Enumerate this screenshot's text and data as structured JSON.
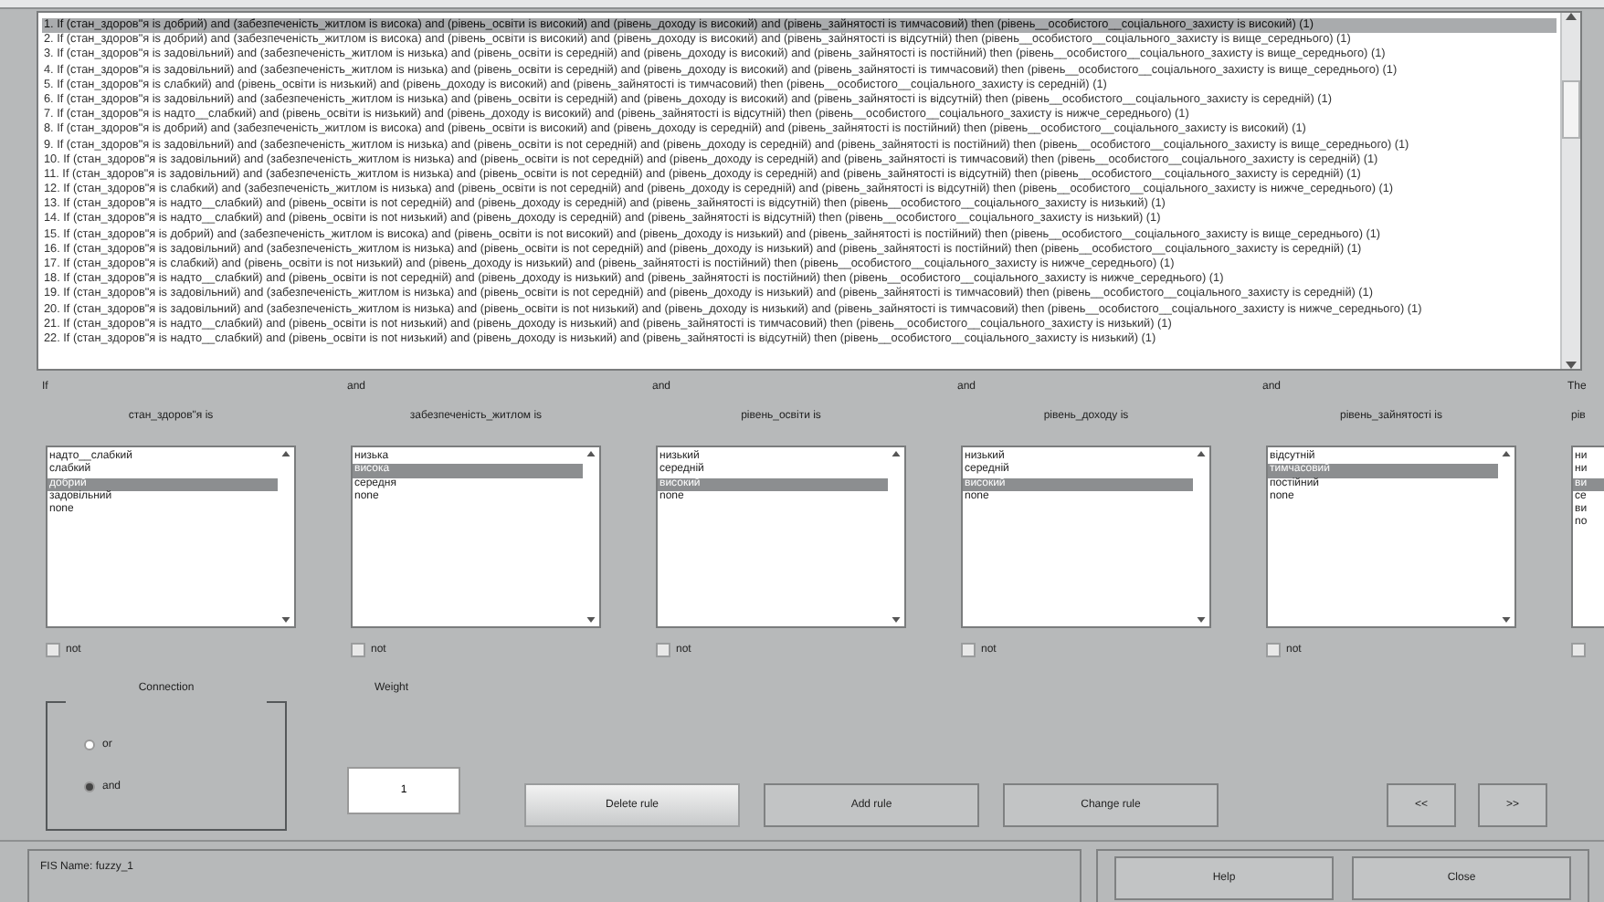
{
  "rules": [
    {
      "text": "1. If (стан_здоров\"я is добрий) and (забезпеченість_житлом is висока) and (рівень_освіти is високий) and (рівень_доходу is високий) and (рівень_зайнятості is тимчасовий) then (рівень__особистого__соціального_захисту is високий) (1)",
      "selected": true
    },
    {
      "text": "2. If (стан_здоров\"я is добрий) and (забезпеченість_житлом is висока) and (рівень_освіти is високий) and (рівень_доходу is високий) and (рівень_зайнятості is відсутній) then (рівень__особистого__соціального_захисту is вище_середнього) (1)",
      "selected": false
    },
    {
      "text": "3. If (стан_здоров\"я is задовільний) and (забезпеченість_житлом is низька) and (рівень_освіти is середній) and (рівень_доходу is високий) and (рівень_зайнятості is постійний) then (рівень__особистого__соціального_захисту is вище_середнього) (1)",
      "selected": false
    },
    {
      "text": "4. If (стан_здоров\"я is задовільний) and (забезпеченість_житлом is низька) and (рівень_освіти is середній) and (рівень_доходу is високий) and (рівень_зайнятості is тимчасовий) then (рівень__особистого__соціального_захисту is вище_середнього) (1)",
      "selected": false
    },
    {
      "text": "5. If (стан_здоров\"я is слабкий) and (рівень_освіти is низький) and (рівень_доходу is високий) and (рівень_зайнятості is тимчасовий) then (рівень__особистого__соціального_захисту is середній) (1)",
      "selected": false
    },
    {
      "text": "6. If (стан_здоров\"я is задовільний) and (забезпеченість_житлом is низька) and (рівень_освіти is середній) and (рівень_доходу is високий) and (рівень_зайнятості is відсутній) then (рівень__особистого__соціального_захисту is середній) (1)",
      "selected": false
    },
    {
      "text": "7. If (стан_здоров\"я is надто__слабкий) and (рівень_освіти is низький) and (рівень_доходу is високий) and (рівень_зайнятості is відсутній) then (рівень__особистого__соціального_захисту is нижче_середнього) (1)",
      "selected": false
    },
    {
      "text": "8. If (стан_здоров\"я is добрий) and (забезпеченість_житлом is висока) and (рівень_освіти is високий) and (рівень_доходу is середній) and (рівень_зайнятості is постійний) then (рівень__особистого__соціального_захисту is високий) (1)",
      "selected": false
    },
    {
      "text": "9. If (стан_здоров\"я is задовільний) and (забезпеченість_житлом is низька) and (рівень_освіти is not середній) and (рівень_доходу is середній) and (рівень_зайнятості is постійний) then (рівень__особистого__соціального_захисту is вище_середнього) (1)",
      "selected": false
    },
    {
      "text": "10. If (стан_здоров\"я is задовільний) and (забезпеченість_житлом is низька) and (рівень_освіти is not середній) and (рівень_доходу is середній) and (рівень_зайнятості is тимчасовий) then (рівень__особистого__соціального_захисту is середній) (1)",
      "selected": false
    },
    {
      "text": "11. If (стан_здоров\"я is задовільний) and (забезпеченість_житлом is низька) and (рівень_освіти is not середній) and (рівень_доходу is середній) and (рівень_зайнятості is відсутній) then (рівень__особистого__соціального_захисту is середній) (1)",
      "selected": false
    },
    {
      "text": "12. If (стан_здоров\"я is слабкий) and (забезпеченість_житлом is низька) and (рівень_освіти is not середній) and (рівень_доходу is середній) and (рівень_зайнятості is відсутній) then (рівень__особистого__соціального_захисту is нижче_середнього) (1)",
      "selected": false
    },
    {
      "text": "13. If (стан_здоров\"я is надто__слабкий) and (рівень_освіти is not середній) and (рівень_доходу is середній) and (рівень_зайнятості is відсутній) then (рівень__особистого__соціального_захисту is низький) (1)",
      "selected": false
    },
    {
      "text": "14. If (стан_здоров\"я is надто__слабкий) and (рівень_освіти is not низький) and (рівень_доходу is середній) and (рівень_зайнятості is відсутній) then (рівень__особистого__соціального_захисту is низький) (1)",
      "selected": false
    },
    {
      "text": "15. If (стан_здоров\"я is добрий) and (забезпеченість_житлом is висока) and (рівень_освіти is not високий) and (рівень_доходу is низький) and (рівень_зайнятості is постійний) then (рівень__особистого__соціального_захисту is вище_середнього) (1)",
      "selected": false
    },
    {
      "text": "16. If (стан_здоров\"я is задовільний) and (забезпеченість_житлом is низька) and (рівень_освіти is not середній) and (рівень_доходу is низький) and (рівень_зайнятості is постійний) then (рівень__особистого__соціального_захисту is середній) (1)",
      "selected": false
    },
    {
      "text": "17. If (стан_здоров\"я is слабкий) and (рівень_освіти is not низький) and (рівень_доходу is низький) and (рівень_зайнятості is постійний) then (рівень__особистого__соціального_захисту is нижче_середнього) (1)",
      "selected": false
    },
    {
      "text": "18. If (стан_здоров\"я is надто__слабкий) and (рівень_освіти is not середній) and (рівень_доходу is низький) and (рівень_зайнятості is постійний) then (рівень__особистого__соціального_захисту is нижче_середнього) (1)",
      "selected": false
    },
    {
      "text": "19. If (стан_здоров\"я is задовільний) and (забезпеченість_житлом is низька) and (рівень_освіти is not середній) and (рівень_доходу is низький) and (рівень_зайнятості is тимчасовий) then (рівень__особистого__соціального_захисту is середній) (1)",
      "selected": false
    },
    {
      "text": "20. If (стан_здоров\"я is задовільний) and (забезпеченість_житлом is низька) and (рівень_освіти is not низький) and (рівень_доходу is низький) and (рівень_зайнятості is тимчасовий) then (рівень__особистого__соціального_захисту is нижче_середнього) (1)",
      "selected": false
    },
    {
      "text": "21. If (стан_здоров\"я is надто__слабкий) and (рівень_освіти is not низький) and (рівень_доходу is низький) and (рівень_зайнятості is тимчасовий) then (рівень__особистого__соціального_захисту is низький) (1)",
      "selected": false
    },
    {
      "text": "22. If (стан_здоров\"я is надто__слабкий) and (рівень_освіти is not низький) and (рівень_доходу is низький) and (рівень_зайнятості is відсутній) then (рівень__особистого__соціального_захисту is низький) (1)",
      "selected": false
    }
  ],
  "columns": [
    {
      "connector": "If",
      "label": "стан_здоров\"я is",
      "options": [
        {
          "text": "надто__слабкий",
          "selected": false
        },
        {
          "text": "слабкий",
          "selected": false
        },
        {
          "text": "добрий",
          "selected": true
        },
        {
          "text": "задовільний",
          "selected": false
        },
        {
          "text": "none",
          "selected": false
        }
      ],
      "negate": {
        "label": "not",
        "checked": false
      }
    },
    {
      "connector": "and",
      "label": "забезпеченість_житлом is",
      "options": [
        {
          "text": "низька",
          "selected": false
        },
        {
          "text": "висока",
          "selected": true
        },
        {
          "text": "середня",
          "selected": false
        },
        {
          "text": "none",
          "selected": false
        }
      ],
      "negate": {
        "label": "not",
        "checked": false
      }
    },
    {
      "connector": "and",
      "label": "рівень_освіти is",
      "options": [
        {
          "text": "низький",
          "selected": false
        },
        {
          "text": "середній",
          "selected": false
        },
        {
          "text": "високий",
          "selected": true
        },
        {
          "text": "none",
          "selected": false
        }
      ],
      "negate": {
        "label": "not",
        "checked": false
      }
    },
    {
      "connector": "and",
      "label": "рівень_доходу is",
      "options": [
        {
          "text": "низький",
          "selected": false
        },
        {
          "text": "середній",
          "selected": false
        },
        {
          "text": "високий",
          "selected": true
        },
        {
          "text": "none",
          "selected": false
        }
      ],
      "negate": {
        "label": "not",
        "checked": false
      }
    },
    {
      "connector": "and",
      "label": "рівень_зайнятості is",
      "options": [
        {
          "text": "відсутній",
          "selected": false
        },
        {
          "text": "тимчасовий",
          "selected": true
        },
        {
          "text": "постійний",
          "selected": false
        },
        {
          "text": "none",
          "selected": false
        }
      ],
      "negate": {
        "label": "not",
        "checked": false
      }
    },
    {
      "connector": "The",
      "label": "рів",
      "options": [
        {
          "text": "ни",
          "selected": false
        },
        {
          "text": "ни",
          "selected": false
        },
        {
          "text": "ви",
          "selected": true
        },
        {
          "text": "се",
          "selected": false
        },
        {
          "text": "ви",
          "selected": false
        },
        {
          "text": "no",
          "selected": false
        }
      ],
      "negate": {
        "checked": false
      }
    }
  ],
  "connection": {
    "title": "Connection",
    "options": [
      {
        "label": "or",
        "selected": false
      },
      {
        "label": "and",
        "selected": true
      }
    ]
  },
  "weight": {
    "label": "Weight",
    "value": "1"
  },
  "buttons": [
    {
      "label": "Delete rule",
      "pressed": true
    },
    {
      "label": "Add rule",
      "pressed": false
    },
    {
      "label": "Change rule",
      "pressed": false
    }
  ],
  "nav_buttons": [
    "<<",
    ">>"
  ],
  "status": "FIS Name: fuzzy_1",
  "footer_buttons": [
    "Help",
    "Close"
  ]
}
